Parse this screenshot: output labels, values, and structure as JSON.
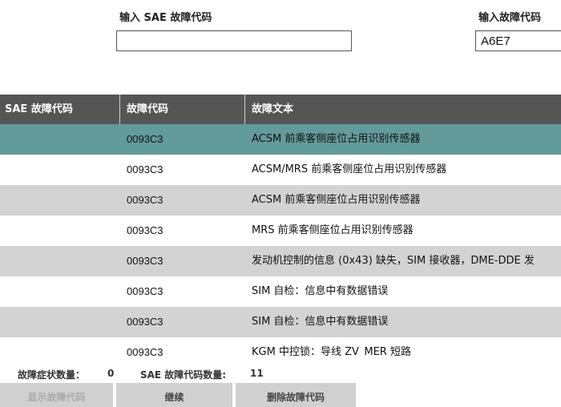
{
  "inputs": {
    "sae_label": "输入 SAE 故障代码",
    "sae_value": "",
    "code_label": "输入故障代码",
    "code_value": "A6E7"
  },
  "table": {
    "headers": [
      "SAE 故障代码",
      "故障代码",
      "故障文本"
    ],
    "rows": [
      {
        "sae": "",
        "code": "0093C3",
        "text": "ACSM 前乘客侧座位占用识别传感器",
        "selected": true
      },
      {
        "sae": "",
        "code": "0093C3",
        "text": "ACSM/MRS 前乘客侧座位占用识别传感器",
        "selected": false
      },
      {
        "sae": "",
        "code": "0093C3",
        "text": "ACSM 前乘客侧座位占用识别传感器",
        "selected": false
      },
      {
        "sae": "",
        "code": "0093C3",
        "text": "MRS 前乘客侧座位占用识别传感器",
        "selected": false
      },
      {
        "sae": "",
        "code": "0093C3",
        "text": "发动机控制的信息 (0x43) 缺失，SIM 接收器，DME-DDE 发",
        "selected": false
      },
      {
        "sae": "",
        "code": "0093C3",
        "text": "SIM 自检：信息中有数据错误",
        "selected": false
      },
      {
        "sae": "",
        "code": "0093C3",
        "text": "SIM 自检：信息中有数据错误",
        "selected": false
      },
      {
        "sae": "",
        "code": "0093C3",
        "text": "KGM 中控锁：导线 ZV_MER 短路",
        "selected": false
      }
    ]
  },
  "footer": {
    "symptom_label": "故障症状数量：",
    "symptom_count": "0",
    "sae_count_label": "SAE 故障代码数量:",
    "sae_count": "11"
  },
  "buttons": {
    "show_label": "显示故障代码",
    "mid_label": "继续",
    "delete_label": "删除故障代码"
  },
  "colors": {
    "header_bg": "#555555",
    "selected_bg": "#639a9a",
    "row_alt_bg": "#d3d3d3",
    "row_bg": "#ffffff"
  }
}
